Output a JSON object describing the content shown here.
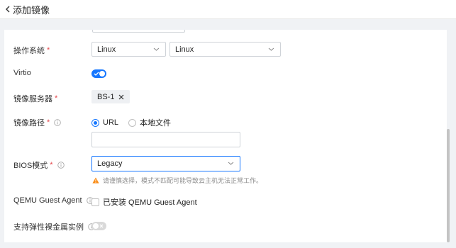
{
  "header": {
    "back_icon": "chevron-left-icon",
    "title": "添加镜像"
  },
  "form": {
    "os": {
      "label": "操作系统",
      "required_mark": "*",
      "type_value": "Linux",
      "distro_value": "Linux"
    },
    "virtio": {
      "label": "Virtio",
      "enabled": true
    },
    "image_server": {
      "label": "镜像服务器",
      "required_mark": "*",
      "selected_tag": "BS-1"
    },
    "image_path": {
      "label": "镜像路径",
      "required_mark": "*",
      "options": [
        "URL",
        "本地文件"
      ],
      "selected": "URL",
      "url_value": ""
    },
    "bios_mode": {
      "label": "BIOS模式",
      "required_mark": "*",
      "value": "Legacy",
      "warning": "请谨慎选择，模式不匹配可能导致云主机无法正常工作。"
    },
    "qemu_agent": {
      "label": "QEMU Guest Agent",
      "checkbox_label": "已安装 QEMU Guest Agent",
      "checked": false
    },
    "bare_metal": {
      "label": "支持弹性裸金属实例",
      "enabled": false
    }
  },
  "colors": {
    "accent": "#1677ff",
    "required": "#e5484d",
    "warning": "#fa8c16"
  }
}
